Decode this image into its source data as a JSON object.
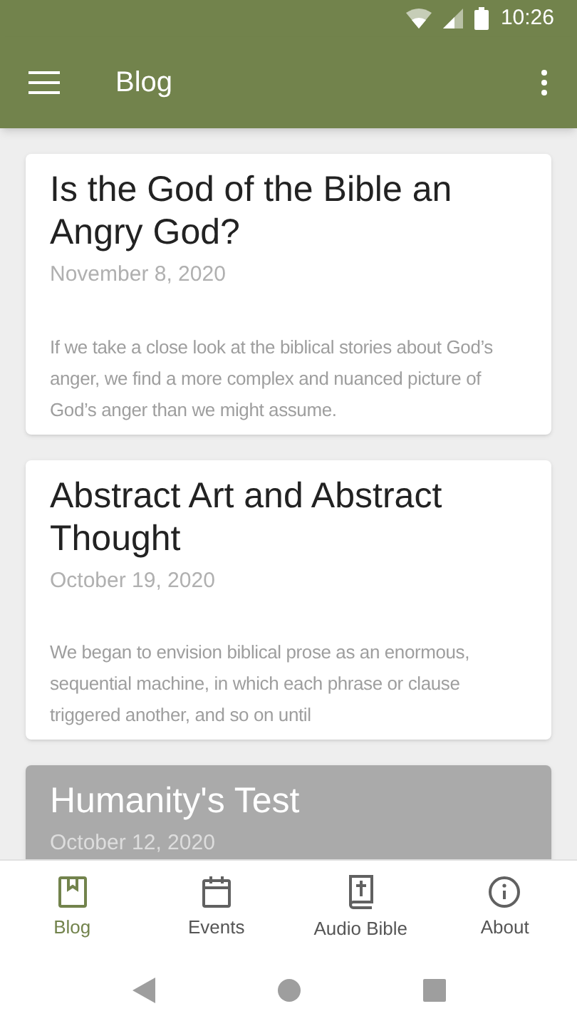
{
  "status_bar": {
    "time": "10:26"
  },
  "app_bar": {
    "title": "Blog"
  },
  "posts": [
    {
      "title": "Is the God of the Bible an Angry God?",
      "date": "November 8, 2020",
      "excerpt": "If we take a close look at the biblical stories about God’s anger, we find a more complex and nuanced picture of God’s anger than we might assume.",
      "highlighted": false
    },
    {
      "title": "Abstract Art and Abstract Thought",
      "date": "October 19, 2020",
      "excerpt": "We began to envision biblical prose as an enormous, sequential machine, in which each phrase or clause triggered another, and so on until",
      "highlighted": false
    },
    {
      "title": "Humanity's Test",
      "date": "October 12, 2020",
      "highlighted": true
    }
  ],
  "bottom_nav": [
    {
      "label": "Blog",
      "kind": "blog",
      "selected": true
    },
    {
      "label": "Events",
      "kind": "events",
      "selected": false
    },
    {
      "label": "Audio Bible",
      "kind": "bible",
      "selected": false
    },
    {
      "label": "About",
      "kind": "about",
      "selected": false
    }
  ]
}
